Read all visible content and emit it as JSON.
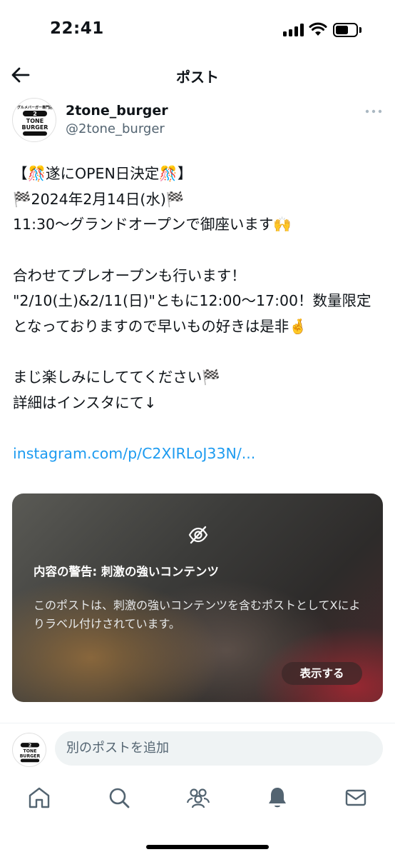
{
  "status": {
    "time": "22:41"
  },
  "header": {
    "title": "ポスト"
  },
  "author": {
    "name": "2tone_burger",
    "handle": "@2tone_burger",
    "logo_top": "グルメバーガー専門店",
    "logo_num": "2",
    "logo_line1": "TONE",
    "logo_line2": "BURGER"
  },
  "post": {
    "line1": "【🎊遂にOPEN日決定🎊】",
    "line2": "🏁2024年2月14日(水)🏁",
    "line3": "11:30〜グランドオープンで御座います🙌",
    "line4": "合わせてプレオープンも行います！",
    "line5": "\"2/10(土)&2/11(日)\"ともに12:00〜17:00！数量限定となっておりますので早いもの好きは是非🤞",
    "line6": "まじ楽しみにしててください🏁",
    "line7": "詳細はインスタにて↓",
    "link": "instagram.com/p/C2XIRLoJ33N/..."
  },
  "media": {
    "warning_title": "内容の警告: 刺激の強いコンテンツ",
    "warning_desc": "このポストは、刺激の強いコンテンツを含むポストとしてXによりラベル付けされています。",
    "show_label": "表示する"
  },
  "reply": {
    "placeholder": "別のポストを追加"
  },
  "icons": {
    "accent": "#1d9bf0",
    "tabs": [
      "home-icon",
      "search-icon",
      "communities-icon",
      "notifications-icon",
      "messages-icon"
    ]
  }
}
